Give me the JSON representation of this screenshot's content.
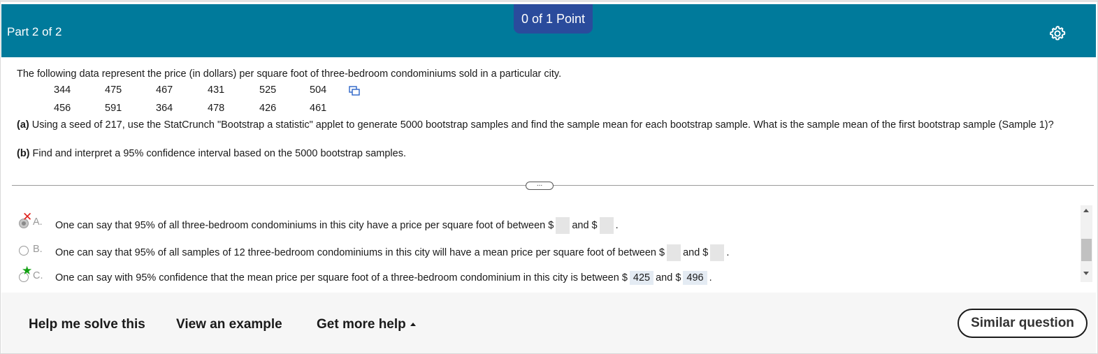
{
  "header": {
    "part_label": "Part 2 of 2",
    "points": "0 of 1 Point",
    "settings_icon": "gear-icon",
    "background_color": "#007a9b",
    "points_color": "#2a4b9c"
  },
  "question": {
    "intro": "The following data represent the price (in dollars) per square foot of three-bedroom condominiums sold in a particular city.",
    "data_rows": [
      [
        "344",
        "475",
        "467",
        "431",
        "525",
        "504"
      ],
      [
        "456",
        "591",
        "364",
        "478",
        "426",
        "461"
      ]
    ],
    "copy_icon": "copy-data-icon",
    "part_a_label": "(a)",
    "part_a_text": "Using a seed of 217, use the StatCrunch \"Bootstrap a statistic\" applet to generate 5000 bootstrap samples and find the sample mean for each bootstrap sample. What is the sample mean of the first bootstrap sample (Sample 1)?",
    "part_b_label": "(b)",
    "part_b_text": "Find and interpret a 95% confidence interval based on the 5000 bootstrap samples."
  },
  "expander_label": "...",
  "choices": [
    {
      "letter": "A.",
      "text_before": "One can say that 95% of all three-bedroom condominiums in this city have a price per square foot of between $",
      "text_middle": "and $",
      "text_after": ".",
      "value_1": "",
      "value_2": "",
      "mark": "incorrect-x-icon",
      "selected": true
    },
    {
      "letter": "B.",
      "text_before": "One can say that 95% of all samples of 12 three-bedroom condominiums in this city will have a mean price per square foot of between $",
      "text_middle": "and $",
      "text_after": ".",
      "value_1": "",
      "value_2": "",
      "mark": "",
      "selected": false
    },
    {
      "letter": "C.",
      "text_before": "One can say with 95% confidence that the mean price per square foot of a three-bedroom condominium in this city is between $",
      "text_middle": "and $",
      "text_after": ".",
      "value_1": "425",
      "value_2": "496",
      "mark": "correct-star-icon",
      "selected": false
    }
  ],
  "footer": {
    "help_solve": "Help me solve this",
    "view_example": "View an example",
    "get_more_help": "Get more help",
    "similar_question": "Similar question"
  }
}
